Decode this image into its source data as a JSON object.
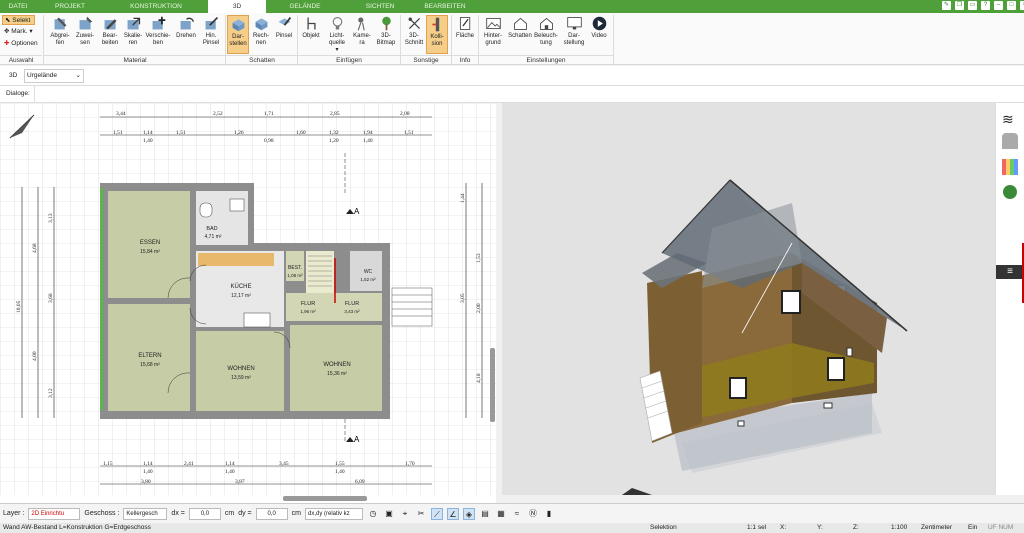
{
  "tabs": [
    "DATEI",
    "PROJEKT",
    "KONSTRUKTION",
    "3D",
    "GELÄNDE",
    "SICHTEN",
    "BEARBEITEN"
  ],
  "active_tab": "3D",
  "accent": "#4fa03a",
  "auswahl": {
    "selekt": "Selekt",
    "mark": "Mark.",
    "optionen": "Optionen",
    "group": "Auswahl"
  },
  "material": {
    "group": "Material",
    "buttons": [
      "Abgrei-fen",
      "Zuwei-sen",
      "Bear-beiten",
      "Skalie-ren",
      "Verschie-ben",
      "Drehen",
      "Hin. Pinsel"
    ]
  },
  "schatten": {
    "group": "Schatten",
    "buttons": [
      "Dar-stellen",
      "Rech-nen",
      "Pinsel"
    ]
  },
  "einfuegen": {
    "group": "Einfügen",
    "buttons": [
      "Objekt",
      "Licht-quelle",
      "Kame-ra",
      "3D-Bitmap"
    ]
  },
  "sonstige": {
    "group": "Sonstige",
    "buttons": [
      "3D-Schnitt",
      "Kolli-sion"
    ]
  },
  "info": {
    "group": "Info",
    "buttons": [
      "Fläche"
    ]
  },
  "einstellungen": {
    "group": "Einstellungen",
    "buttons": [
      "Hinter-grund",
      "Schatten",
      "Beleuch-tung",
      "Dar-stellung",
      "Video"
    ]
  },
  "viewbar": {
    "mode": "3D",
    "terrain": "Urgelände"
  },
  "dialoge": "Dialoge:",
  "plan": {
    "rooms": [
      {
        "name": "ESSEN",
        "area": "15,84 m²"
      },
      {
        "name": "BAD",
        "area": "4,71 m²"
      },
      {
        "name": "KÜCHE",
        "area": "12,17 m²"
      },
      {
        "name": "BEST.",
        "area": "1,08 m²"
      },
      {
        "name": "WC",
        "area": "1,52 m²"
      },
      {
        "name": "FLUR",
        "area": "1,96 m²"
      },
      {
        "name": "FLUR",
        "area": "3,43 m²"
      },
      {
        "name": "ELTERN",
        "area": "15,68 m²"
      },
      {
        "name": "WOHNEN",
        "area": "13,59 m²"
      },
      {
        "name": "WOHNEN",
        "area": "15,36 m²"
      }
    ],
    "section_label": "A",
    "dims_top1": [
      "3,44",
      "2,52",
      "1,71",
      "2,85",
      "2,08"
    ],
    "dims_top2": [
      "1,51",
      "1,14",
      "1,51",
      "1,26",
      "1,60",
      "1,32",
      "1,94",
      "1,51"
    ],
    "dims_top2_sub": [
      "1,40",
      "0,98",
      "1,20",
      "1,40"
    ],
    "dims_bottom1": [
      "1,15",
      "1,14",
      "2,41",
      "1,14",
      "3,45",
      "1,55",
      "1,70"
    ],
    "dims_bottom1_sub": [
      "1,40",
      "1,40",
      "1,40"
    ],
    "dims_bottom2": [
      "3,80",
      "3,87",
      "6,09"
    ],
    "dims_left": [
      "3,13",
      "4,68",
      "3,68",
      "4,00",
      "3,12",
      "10,05"
    ],
    "dims_right": [
      "1,53",
      "3,05",
      "2,00",
      "4,18",
      "1,44"
    ]
  },
  "bottombar": {
    "layer_label": "Layer :",
    "layer_value": "2D Einrichtu",
    "geschoss_label": "Geschoss :",
    "geschoss_value": "Kellergesch",
    "dx_label": "dx =",
    "dx_value": "0,0",
    "dy_label": "dy =",
    "dy_value": "0,0",
    "unit": "cm",
    "dxdy_mode": "dx,dy (relativ kz"
  },
  "status": {
    "left": "Wand AW-Bestand L=Konstruktion G=Erdgeschoss",
    "mode": "Selektion",
    "scale": "1:1 sel",
    "x": "X:",
    "y": "Y:",
    "z": "Z:",
    "ratio": "1:100",
    "unit": "Zentimeter",
    "ein": "Ein",
    "flags": "UF NUM"
  }
}
